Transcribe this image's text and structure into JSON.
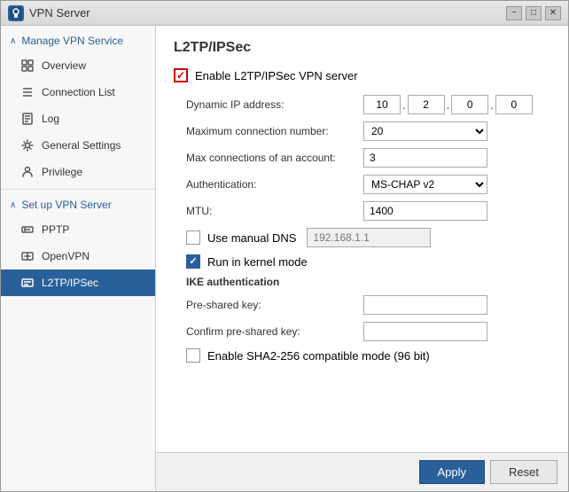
{
  "window": {
    "title": "VPN Server",
    "app_icon_label": "VPN",
    "titlebar_minimize": "−",
    "titlebar_maximize": "□",
    "titlebar_close": "✕"
  },
  "sidebar": {
    "manage_section": {
      "label": "Manage VPN Service",
      "chevron": "∧"
    },
    "items": [
      {
        "id": "overview",
        "label": "Overview",
        "icon": "overview"
      },
      {
        "id": "connection-list",
        "label": "Connection List",
        "icon": "list"
      },
      {
        "id": "log",
        "label": "Log",
        "icon": "log"
      },
      {
        "id": "general-settings",
        "label": "General Settings",
        "icon": "settings"
      },
      {
        "id": "privilege",
        "label": "Privilege",
        "icon": "user"
      }
    ],
    "setup_section": {
      "label": "Set up VPN Server",
      "chevron": "∧"
    },
    "setup_items": [
      {
        "id": "pptp",
        "label": "PPTP",
        "icon": "pptp"
      },
      {
        "id": "openvpn",
        "label": "OpenVPN",
        "icon": "openvpn"
      },
      {
        "id": "l2tp",
        "label": "L2TP/IPSec",
        "icon": "l2tp",
        "active": true
      }
    ]
  },
  "main": {
    "page_title": "L2TP/IPSec",
    "enable_label": "Enable L2TP/IPSec VPN server",
    "fields": {
      "dynamic_ip_label": "Dynamic IP address:",
      "ip_octet1": "10",
      "ip_octet2": "2",
      "ip_octet3": "0",
      "ip_octet4": "0",
      "max_connection_label": "Maximum connection number:",
      "max_connection_value": "20",
      "max_per_account_label": "Max connections of an account:",
      "max_per_account_value": "3",
      "authentication_label": "Authentication:",
      "authentication_value": "MS-CHAP v2",
      "mtu_label": "MTU:",
      "mtu_value": "1400",
      "use_manual_dns_label": "Use manual DNS",
      "dns_ip_placeholder": "192.168.1.1",
      "run_kernel_label": "Run in kernel mode",
      "ike_section_label": "IKE authentication",
      "pre_shared_key_label": "Pre-shared key:",
      "confirm_pre_shared_key_label": "Confirm pre-shared key:",
      "sha2_label": "Enable SHA2-256 compatible mode (96 bit)"
    },
    "footer": {
      "apply_label": "Apply",
      "reset_label": "Reset"
    }
  }
}
